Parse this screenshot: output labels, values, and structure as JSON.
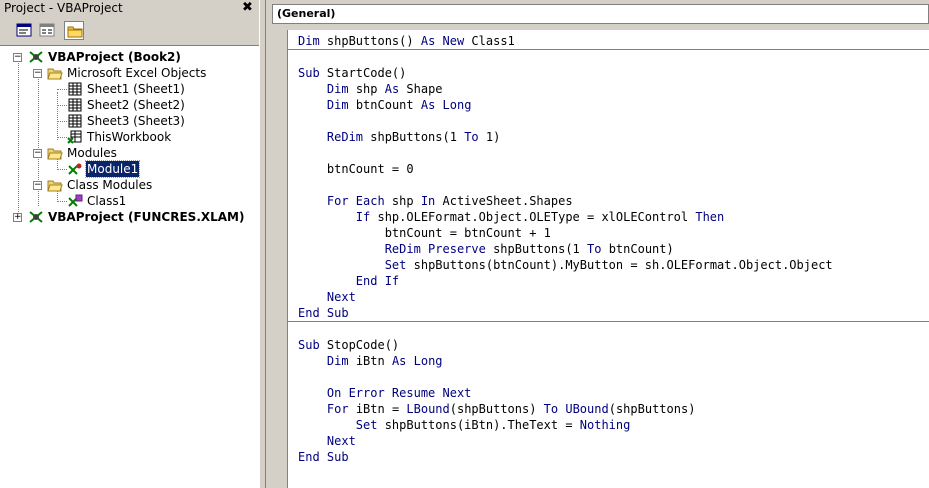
{
  "project": {
    "title": "Project - VBAProject",
    "close_glyph": "✖",
    "toolbar": {
      "view_code_icon": "view-code-icon",
      "view_object_icon": "view-object-icon",
      "toggle_folders_icon": "toggle-folders-icon"
    },
    "tree": [
      {
        "label": "VBAProject (Book2)",
        "bold": true
      },
      {
        "label": "Microsoft Excel Objects"
      },
      {
        "label": "Sheet1 (Sheet1)"
      },
      {
        "label": "Sheet2 (Sheet2)"
      },
      {
        "label": "Sheet3 (Sheet3)"
      },
      {
        "label": "ThisWorkbook"
      },
      {
        "label": "Modules"
      },
      {
        "label": "Module1",
        "selected": true
      },
      {
        "label": "Class Modules"
      },
      {
        "label": "Class1"
      },
      {
        "label": "VBAProject (FUNCRES.XLAM)",
        "bold": true
      }
    ]
  },
  "code_window": {
    "object_combo": "(General)",
    "keyword_color": "#00007f",
    "lines": [
      [
        {
          "k": true,
          "t": "Dim"
        },
        {
          "t": " shpButtons() "
        },
        {
          "k": true,
          "t": "As New"
        },
        {
          "t": " Class1"
        }
      ],
      [],
      [
        {
          "k": true,
          "t": "Sub"
        },
        {
          "t": " StartCode()"
        }
      ],
      [
        {
          "t": "    "
        },
        {
          "k": true,
          "t": "Dim"
        },
        {
          "t": " shp "
        },
        {
          "k": true,
          "t": "As"
        },
        {
          "t": " Shape"
        }
      ],
      [
        {
          "t": "    "
        },
        {
          "k": true,
          "t": "Dim"
        },
        {
          "t": " btnCount "
        },
        {
          "k": true,
          "t": "As Long"
        }
      ],
      [],
      [
        {
          "t": "    "
        },
        {
          "k": true,
          "t": "ReDim"
        },
        {
          "t": " shpButtons(1 "
        },
        {
          "k": true,
          "t": "To"
        },
        {
          "t": " 1)"
        }
      ],
      [],
      [
        {
          "t": "    btnCount = 0"
        }
      ],
      [],
      [
        {
          "t": "    "
        },
        {
          "k": true,
          "t": "For Each"
        },
        {
          "t": " shp "
        },
        {
          "k": true,
          "t": "In"
        },
        {
          "t": " ActiveSheet.Shapes"
        }
      ],
      [
        {
          "t": "        "
        },
        {
          "k": true,
          "t": "If"
        },
        {
          "t": " shp.OLEFormat.Object.OLEType = xlOLEControl "
        },
        {
          "k": true,
          "t": "Then"
        }
      ],
      [
        {
          "t": "            btnCount = btnCount + 1"
        }
      ],
      [
        {
          "t": "            "
        },
        {
          "k": true,
          "t": "ReDim Preserve"
        },
        {
          "t": " shpButtons(1 "
        },
        {
          "k": true,
          "t": "To"
        },
        {
          "t": " btnCount)"
        }
      ],
      [
        {
          "t": "            "
        },
        {
          "k": true,
          "t": "Set"
        },
        {
          "t": " shpButtons(btnCount).MyButton = sh.OLEFormat.Object.Object"
        }
      ],
      [
        {
          "t": "        "
        },
        {
          "k": true,
          "t": "End If"
        }
      ],
      [
        {
          "t": "    "
        },
        {
          "k": true,
          "t": "Next"
        }
      ],
      [
        {
          "k": true,
          "t": "End Sub"
        }
      ],
      [],
      [
        {
          "k": true,
          "t": "Sub"
        },
        {
          "t": " StopCode()"
        }
      ],
      [
        {
          "t": "    "
        },
        {
          "k": true,
          "t": "Dim"
        },
        {
          "t": " iBtn "
        },
        {
          "k": true,
          "t": "As Long"
        }
      ],
      [],
      [
        {
          "t": "    "
        },
        {
          "k": true,
          "t": "On Error Resume Next"
        }
      ],
      [
        {
          "t": "    "
        },
        {
          "k": true,
          "t": "For"
        },
        {
          "t": " iBtn = "
        },
        {
          "k": true,
          "t": "LBound"
        },
        {
          "t": "(shpButtons) "
        },
        {
          "k": true,
          "t": "To"
        },
        {
          "t": " "
        },
        {
          "k": true,
          "t": "UBound"
        },
        {
          "t": "(shpButtons)"
        }
      ],
      [
        {
          "t": "        "
        },
        {
          "k": true,
          "t": "Set"
        },
        {
          "t": " shpButtons(iBtn).TheText = "
        },
        {
          "k": true,
          "t": "Nothing"
        }
      ],
      [
        {
          "t": "    "
        },
        {
          "k": true,
          "t": "Next"
        }
      ],
      [
        {
          "k": true,
          "t": "End Sub"
        }
      ]
    ]
  }
}
